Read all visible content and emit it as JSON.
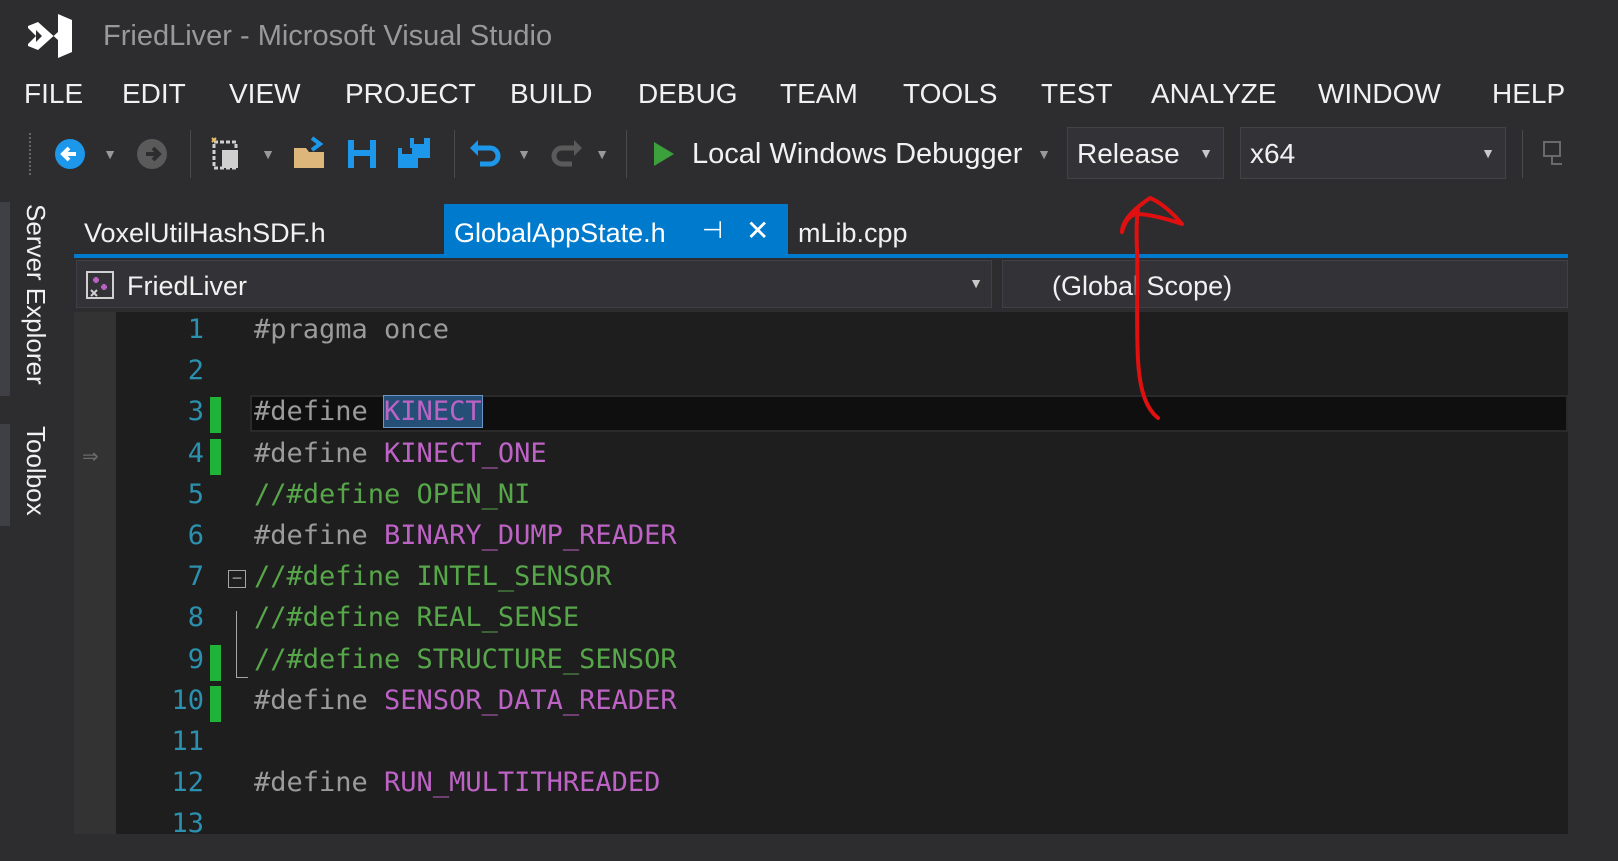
{
  "window": {
    "title": "FriedLiver - Microsoft Visual Studio"
  },
  "menu": [
    "FILE",
    "EDIT",
    "VIEW",
    "PROJECT",
    "BUILD",
    "DEBUG",
    "TEAM",
    "TOOLS",
    "TEST",
    "ANALYZE",
    "WINDOW",
    "HELP"
  ],
  "toolbar": {
    "debugger_label": "Local Windows Debugger",
    "configuration": "Release",
    "platform": "x64"
  },
  "side_panels": [
    "Server Explorer",
    "Toolbox"
  ],
  "tabs": [
    {
      "label": "VoxelUtilHashSDF.h",
      "active": false
    },
    {
      "label": "GlobalAppState.h",
      "active": true,
      "pin": "⊣",
      "close": "✕"
    },
    {
      "label": "mLib.cpp",
      "active": false
    }
  ],
  "navbar": {
    "project": "FriedLiver",
    "scope": "(Global Scope)"
  },
  "code": [
    {
      "n": "1",
      "parts": [
        [
          "kw-pre",
          "#pragma once"
        ]
      ]
    },
    {
      "n": "2",
      "parts": []
    },
    {
      "n": "3",
      "parts": [
        [
          "kw-pre",
          "#define "
        ],
        [
          "macro sel",
          "KINECT"
        ]
      ],
      "changed": true,
      "current": true
    },
    {
      "n": "4",
      "parts": [
        [
          "kw-pre",
          "#define "
        ],
        [
          "macro",
          "KINECT_ONE"
        ]
      ],
      "changed": true
    },
    {
      "n": "5",
      "parts": [
        [
          "comment",
          "//#define OPEN_NI"
        ]
      ]
    },
    {
      "n": "6",
      "parts": [
        [
          "kw-pre",
          "#define "
        ],
        [
          "macro",
          "BINARY_DUMP_READER"
        ]
      ]
    },
    {
      "n": "7",
      "parts": [
        [
          "comment",
          "//#define INTEL_SENSOR"
        ]
      ],
      "fold": true
    },
    {
      "n": "8",
      "parts": [
        [
          "comment",
          "//#define REAL_SENSE"
        ]
      ]
    },
    {
      "n": "9",
      "parts": [
        [
          "comment",
          "//#define STRUCTURE_SENSOR"
        ]
      ],
      "changed": true
    },
    {
      "n": "10",
      "parts": [
        [
          "kw-pre",
          "#define "
        ],
        [
          "macro",
          "SENSOR_DATA_READER"
        ]
      ],
      "changed": true
    },
    {
      "n": "11",
      "parts": []
    },
    {
      "n": "12",
      "parts": [
        [
          "kw-pre",
          "#define "
        ],
        [
          "macro",
          "RUN_MULTITHREADED"
        ]
      ]
    },
    {
      "n": "13",
      "parts": []
    }
  ],
  "colors": {
    "accent": "#007acc",
    "annotation": "#e01010",
    "changed": "#1fb339"
  }
}
